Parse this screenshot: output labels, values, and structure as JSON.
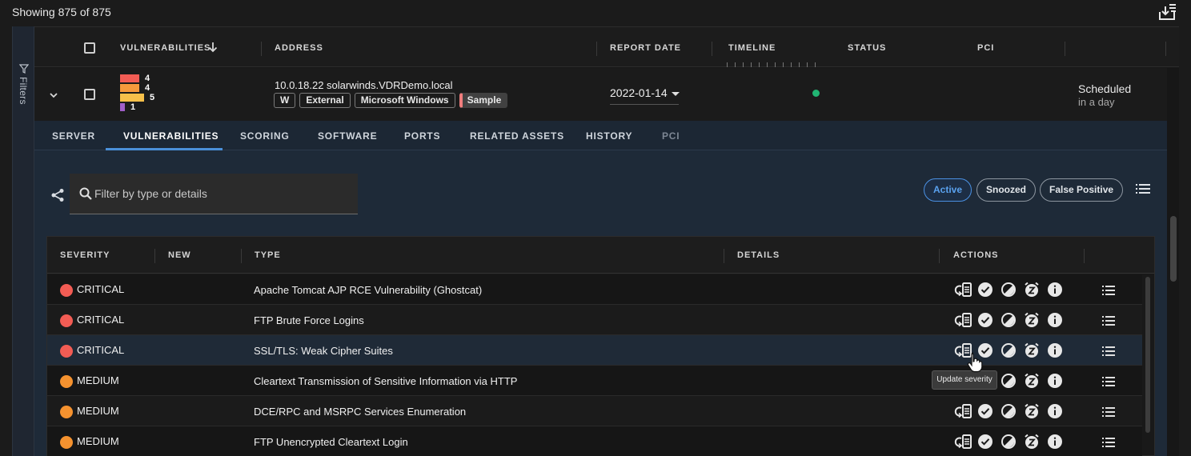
{
  "toolbar": {
    "showing_text": "Showing 875 of 875",
    "export_icon": "export-download-icon"
  },
  "filters": {
    "label": "Filters"
  },
  "columns": {
    "vulnerabilities": "VULNERABILITIES",
    "address": "ADDRESS",
    "report_date": "REPORT DATE",
    "timeline": "TIMELINE",
    "status": "STATUS",
    "pci": "PCI"
  },
  "asset": {
    "severity_counts": [
      {
        "count": "4",
        "color": "#f25c54"
      },
      {
        "count": "4",
        "color": "#f59a3c"
      },
      {
        "count": "5",
        "color": "#f7c04a"
      },
      {
        "count": "1",
        "color": "#a05fc9"
      }
    ],
    "address": "10.0.18.22 solarwinds.VDRDemo.local",
    "tags": {
      "w": "W",
      "external": "External",
      "windows": "Microsoft Windows",
      "sample": "Sample"
    },
    "report_date": "2022-01-14",
    "status_color": "#21b573",
    "schedule": "Scheduled",
    "schedule_sub": "in a day"
  },
  "tabs": {
    "server": "SERVER",
    "vulnerabilities": "VULNERABILITIES",
    "scoring": "SCORING",
    "software": "SOFTWARE",
    "ports": "PORTS",
    "related_assets": "RELATED ASSETS",
    "history": "HISTORY",
    "pci": "PCI",
    "active": "vulnerabilities"
  },
  "search": {
    "placeholder": "Filter by type or details",
    "value": ""
  },
  "filter_pills": {
    "active": "Active",
    "snoozed": "Snoozed",
    "false_positive": "False Positive",
    "selected": "Active"
  },
  "vuln_table": {
    "headers": {
      "severity": "SEVERITY",
      "new": "NEW",
      "type": "TYPE",
      "details": "DETAILS",
      "actions": "ACTIONS"
    },
    "rows": [
      {
        "severity": "CRITICAL",
        "color": "#f25c54",
        "type": "Apache Tomcat AJP RCE Vulnerability (Ghostcat)"
      },
      {
        "severity": "CRITICAL",
        "color": "#f25c54",
        "type": "FTP Brute Force Logins"
      },
      {
        "severity": "CRITICAL",
        "color": "#f25c54",
        "type": "SSL/TLS: Weak Cipher Suites"
      },
      {
        "severity": "MEDIUM",
        "color": "#f5922f",
        "type": "Cleartext Transmission of Sensitive Information via HTTP"
      },
      {
        "severity": "MEDIUM",
        "color": "#f5922f",
        "type": "DCE/RPC and MSRPC Services Enumeration"
      },
      {
        "severity": "MEDIUM",
        "color": "#f5922f",
        "type": "FTP Unencrypted Cleartext Login"
      }
    ]
  },
  "tooltip": {
    "text": "Update severity"
  }
}
